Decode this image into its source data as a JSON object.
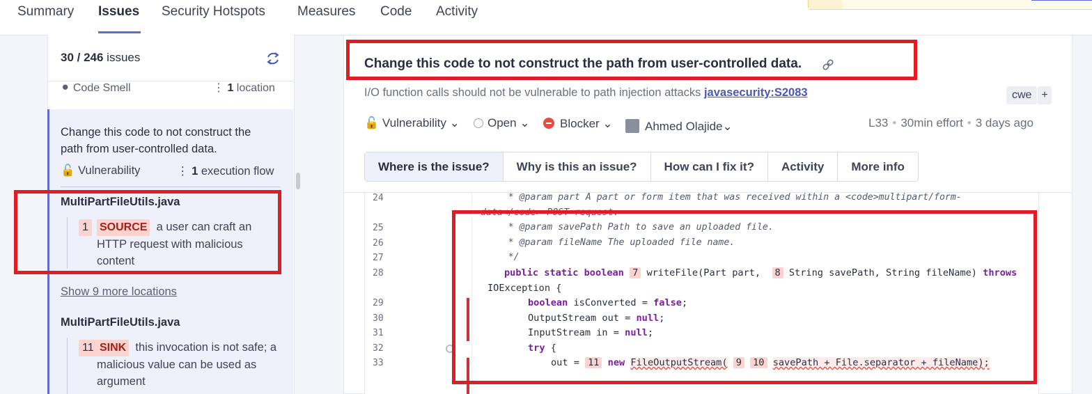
{
  "nav": {
    "tabs": [
      "Summary",
      "Issues",
      "Security Hotspots",
      "Measures",
      "Code",
      "Activity"
    ]
  },
  "list": {
    "count_bold": "30 / 246",
    "count_suffix": " issues",
    "smell": {
      "type": "Code Smell",
      "loc_count": "1",
      "loc_label": " location"
    },
    "selected": {
      "title": "Change this code to not construct the path from user-controlled data.",
      "type": "Vulnerability",
      "flow_count": "1",
      "flow_label": " execution flow"
    },
    "file1": "MultiPartFileUtils.java",
    "loc1": {
      "num": "1",
      "kind": "SOURCE",
      "text": "a user can craft an HTTP request with malicious content"
    },
    "show_more": "Show 9 more locations",
    "file2": "MultiPartFileUtils.java",
    "loc2": {
      "num": "11",
      "kind": "SINK",
      "text": "this invocation is not safe; a malicious value can be used as argument"
    }
  },
  "issue": {
    "title": "Change this code to not construct the path from user-controlled data.",
    "rule_desc": "I/O function calls should not be vulnerable to path injection attacks ",
    "rule_key": "javasecurity:S2083",
    "tag": "cwe",
    "tag_add": "+",
    "type": "Vulnerability",
    "status": "Open",
    "severity": "Blocker",
    "assignee": "Ahmed Olajide",
    "line": "L33",
    "effort": "30min effort",
    "age": "3 days ago",
    "tabs": [
      "Where is the issue?",
      "Why is this an issue?",
      "How can I fix it?",
      "Activity",
      "More info"
    ]
  },
  "code": {
    "line_numbers": [
      "24",
      "25",
      "26",
      "27",
      "28",
      "29",
      "30",
      "31",
      "32",
      "33"
    ],
    "l24": "     * @param part A part or form item that was received within a <code>multipart/form-",
    "l24b": "data</code> POST request.",
    "l25": "     * @param savePath Path to save an uploaded file.",
    "l26": "     * @param fileName The uploaded file name.",
    "l27": "     */",
    "l28_kw": "public static boolean",
    "l28_b7": "7",
    "l28_a": "writeFile(Part part,",
    "l28_b8": "8",
    "l28_b": "String savePath, String fileName)",
    "l28_throws": "throws",
    "l28_c": "IOException {",
    "l29_kw": "boolean",
    "l29_a": " isConverted = ",
    "l29_false": "false",
    "l29_end": ";",
    "l30_a": "OutputStream out = ",
    "l30_null": "null",
    "l30_end": ";",
    "l31_a": "InputStream in = ",
    "l31_null": "null",
    "l31_end": ";",
    "l32_kw": "try",
    "l32_end": " {",
    "l33_a": "out = ",
    "l33_b11": "11",
    "l33_new": "new",
    "l33_b": "FileOutputStream(",
    "l33_b9": "9",
    "l33_b10": "10",
    "l33_c": "savePath + File.separator + fileName);"
  },
  "colors": {
    "accent": "#5d6cd0",
    "annotation": "#e01c25",
    "highlight": "#fbd3cf"
  }
}
